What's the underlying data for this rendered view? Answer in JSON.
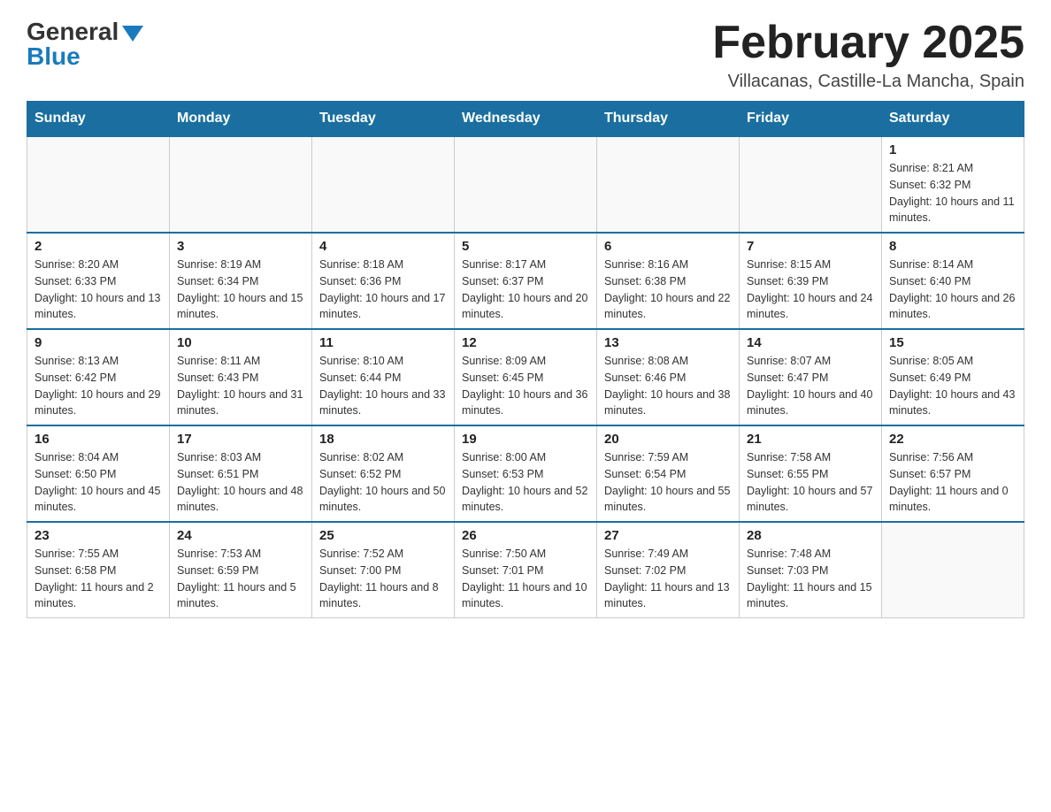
{
  "logo": {
    "general": "General",
    "blue": "Blue"
  },
  "title": "February 2025",
  "location": "Villacanas, Castille-La Mancha, Spain",
  "days_of_week": [
    "Sunday",
    "Monday",
    "Tuesday",
    "Wednesday",
    "Thursday",
    "Friday",
    "Saturday"
  ],
  "weeks": [
    [
      {
        "day": "",
        "sunrise": "",
        "sunset": "",
        "daylight": ""
      },
      {
        "day": "",
        "sunrise": "",
        "sunset": "",
        "daylight": ""
      },
      {
        "day": "",
        "sunrise": "",
        "sunset": "",
        "daylight": ""
      },
      {
        "day": "",
        "sunrise": "",
        "sunset": "",
        "daylight": ""
      },
      {
        "day": "",
        "sunrise": "",
        "sunset": "",
        "daylight": ""
      },
      {
        "day": "",
        "sunrise": "",
        "sunset": "",
        "daylight": ""
      },
      {
        "day": "1",
        "sunrise": "Sunrise: 8:21 AM",
        "sunset": "Sunset: 6:32 PM",
        "daylight": "Daylight: 10 hours and 11 minutes."
      }
    ],
    [
      {
        "day": "2",
        "sunrise": "Sunrise: 8:20 AM",
        "sunset": "Sunset: 6:33 PM",
        "daylight": "Daylight: 10 hours and 13 minutes."
      },
      {
        "day": "3",
        "sunrise": "Sunrise: 8:19 AM",
        "sunset": "Sunset: 6:34 PM",
        "daylight": "Daylight: 10 hours and 15 minutes."
      },
      {
        "day": "4",
        "sunrise": "Sunrise: 8:18 AM",
        "sunset": "Sunset: 6:36 PM",
        "daylight": "Daylight: 10 hours and 17 minutes."
      },
      {
        "day": "5",
        "sunrise": "Sunrise: 8:17 AM",
        "sunset": "Sunset: 6:37 PM",
        "daylight": "Daylight: 10 hours and 20 minutes."
      },
      {
        "day": "6",
        "sunrise": "Sunrise: 8:16 AM",
        "sunset": "Sunset: 6:38 PM",
        "daylight": "Daylight: 10 hours and 22 minutes."
      },
      {
        "day": "7",
        "sunrise": "Sunrise: 8:15 AM",
        "sunset": "Sunset: 6:39 PM",
        "daylight": "Daylight: 10 hours and 24 minutes."
      },
      {
        "day": "8",
        "sunrise": "Sunrise: 8:14 AM",
        "sunset": "Sunset: 6:40 PM",
        "daylight": "Daylight: 10 hours and 26 minutes."
      }
    ],
    [
      {
        "day": "9",
        "sunrise": "Sunrise: 8:13 AM",
        "sunset": "Sunset: 6:42 PM",
        "daylight": "Daylight: 10 hours and 29 minutes."
      },
      {
        "day": "10",
        "sunrise": "Sunrise: 8:11 AM",
        "sunset": "Sunset: 6:43 PM",
        "daylight": "Daylight: 10 hours and 31 minutes."
      },
      {
        "day": "11",
        "sunrise": "Sunrise: 8:10 AM",
        "sunset": "Sunset: 6:44 PM",
        "daylight": "Daylight: 10 hours and 33 minutes."
      },
      {
        "day": "12",
        "sunrise": "Sunrise: 8:09 AM",
        "sunset": "Sunset: 6:45 PM",
        "daylight": "Daylight: 10 hours and 36 minutes."
      },
      {
        "day": "13",
        "sunrise": "Sunrise: 8:08 AM",
        "sunset": "Sunset: 6:46 PM",
        "daylight": "Daylight: 10 hours and 38 minutes."
      },
      {
        "day": "14",
        "sunrise": "Sunrise: 8:07 AM",
        "sunset": "Sunset: 6:47 PM",
        "daylight": "Daylight: 10 hours and 40 minutes."
      },
      {
        "day": "15",
        "sunrise": "Sunrise: 8:05 AM",
        "sunset": "Sunset: 6:49 PM",
        "daylight": "Daylight: 10 hours and 43 minutes."
      }
    ],
    [
      {
        "day": "16",
        "sunrise": "Sunrise: 8:04 AM",
        "sunset": "Sunset: 6:50 PM",
        "daylight": "Daylight: 10 hours and 45 minutes."
      },
      {
        "day": "17",
        "sunrise": "Sunrise: 8:03 AM",
        "sunset": "Sunset: 6:51 PM",
        "daylight": "Daylight: 10 hours and 48 minutes."
      },
      {
        "day": "18",
        "sunrise": "Sunrise: 8:02 AM",
        "sunset": "Sunset: 6:52 PM",
        "daylight": "Daylight: 10 hours and 50 minutes."
      },
      {
        "day": "19",
        "sunrise": "Sunrise: 8:00 AM",
        "sunset": "Sunset: 6:53 PM",
        "daylight": "Daylight: 10 hours and 52 minutes."
      },
      {
        "day": "20",
        "sunrise": "Sunrise: 7:59 AM",
        "sunset": "Sunset: 6:54 PM",
        "daylight": "Daylight: 10 hours and 55 minutes."
      },
      {
        "day": "21",
        "sunrise": "Sunrise: 7:58 AM",
        "sunset": "Sunset: 6:55 PM",
        "daylight": "Daylight: 10 hours and 57 minutes."
      },
      {
        "day": "22",
        "sunrise": "Sunrise: 7:56 AM",
        "sunset": "Sunset: 6:57 PM",
        "daylight": "Daylight: 11 hours and 0 minutes."
      }
    ],
    [
      {
        "day": "23",
        "sunrise": "Sunrise: 7:55 AM",
        "sunset": "Sunset: 6:58 PM",
        "daylight": "Daylight: 11 hours and 2 minutes."
      },
      {
        "day": "24",
        "sunrise": "Sunrise: 7:53 AM",
        "sunset": "Sunset: 6:59 PM",
        "daylight": "Daylight: 11 hours and 5 minutes."
      },
      {
        "day": "25",
        "sunrise": "Sunrise: 7:52 AM",
        "sunset": "Sunset: 7:00 PM",
        "daylight": "Daylight: 11 hours and 8 minutes."
      },
      {
        "day": "26",
        "sunrise": "Sunrise: 7:50 AM",
        "sunset": "Sunset: 7:01 PM",
        "daylight": "Daylight: 11 hours and 10 minutes."
      },
      {
        "day": "27",
        "sunrise": "Sunrise: 7:49 AM",
        "sunset": "Sunset: 7:02 PM",
        "daylight": "Daylight: 11 hours and 13 minutes."
      },
      {
        "day": "28",
        "sunrise": "Sunrise: 7:48 AM",
        "sunset": "Sunset: 7:03 PM",
        "daylight": "Daylight: 11 hours and 15 minutes."
      },
      {
        "day": "",
        "sunrise": "",
        "sunset": "",
        "daylight": ""
      }
    ]
  ]
}
